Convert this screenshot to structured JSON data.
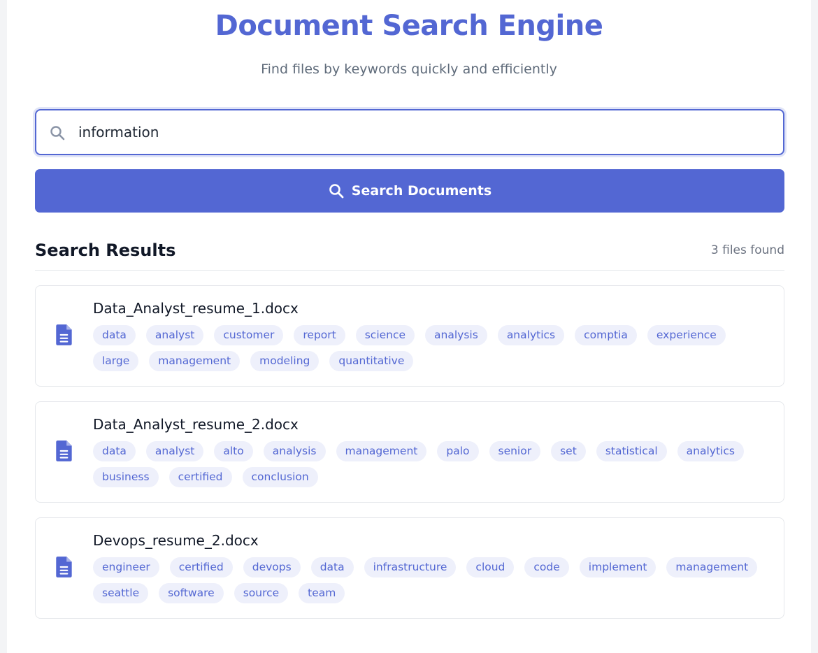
{
  "header": {
    "title": "Document Search Engine",
    "subtitle": "Find files by keywords quickly and efficiently"
  },
  "search": {
    "value": "information",
    "button_label": "Search Documents",
    "icon": "search-icon"
  },
  "results": {
    "title": "Search Results",
    "count_text": "3 files found",
    "items": [
      {
        "file_name": "Data_Analyst_resume_1.docx",
        "icon": "document-icon",
        "tags": [
          "data",
          "analyst",
          "customer",
          "report",
          "science",
          "analysis",
          "analytics",
          "comptia",
          "experience",
          "large",
          "management",
          "modeling",
          "quantitative"
        ]
      },
      {
        "file_name": "Data_Analyst_resume_2.docx",
        "icon": "document-icon",
        "tags": [
          "data",
          "analyst",
          "alto",
          "analysis",
          "management",
          "palo",
          "senior",
          "set",
          "statistical",
          "analytics",
          "business",
          "certified",
          "conclusion"
        ]
      },
      {
        "file_name": "Devops_resume_2.docx",
        "icon": "document-icon",
        "tags": [
          "engineer",
          "certified",
          "devops",
          "data",
          "infrastructure",
          "cloud",
          "code",
          "implement",
          "management",
          "seattle",
          "software",
          "source",
          "team"
        ]
      }
    ]
  },
  "colors": {
    "accent": "#5367d3",
    "tag_bg": "#eef0fb",
    "text_dark": "#111827",
    "text_muted": "#6b7280"
  }
}
